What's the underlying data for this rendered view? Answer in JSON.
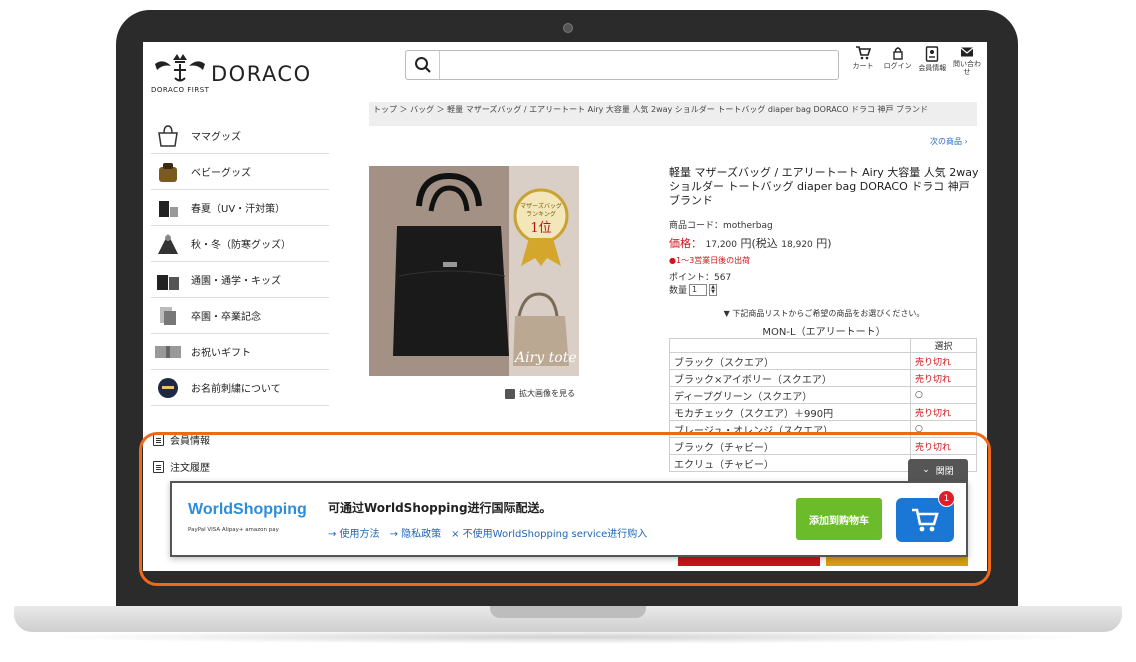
{
  "header": {
    "logo_name": "DORACO",
    "logo_sub": "DORACO FIRST",
    "search_placeholder": "",
    "icons": [
      {
        "label": "カート",
        "icon": "cart-icon"
      },
      {
        "label": "ログイン",
        "icon": "login-icon"
      },
      {
        "label": "会員情報",
        "icon": "member-icon"
      },
      {
        "label": "問い合わせ",
        "icon": "mail-icon"
      }
    ]
  },
  "breadcrumb": "トップ ＞ バッグ ＞ 軽量 マザーズバッグ / エアリートート Airy 大容量 人気 2way ショルダー トートバッグ diaper bag  DORACO ドラコ 神戸 ブランド",
  "next_link": "次の商品",
  "sidebar": {
    "items": [
      {
        "label": "ママグッズ"
      },
      {
        "label": "ベビーグッズ"
      },
      {
        "label": "春夏（UV・汗対策）"
      },
      {
        "label": "秋・冬（防寒グッズ）"
      },
      {
        "label": "通園・通学・キッズ"
      },
      {
        "label": "卒園・卒業記念"
      },
      {
        "label": "お祝いギフト"
      },
      {
        "label": "お名前刺繍について"
      }
    ],
    "links": [
      {
        "label": "会員情報"
      },
      {
        "label": "注文履歴"
      }
    ]
  },
  "product": {
    "badge_line1": "マザーズバッグ",
    "badge_line2": "ランキング",
    "badge_rank": "1位",
    "script_text": "Airy tote",
    "zoom_label": "拡大画像を見る",
    "title": "軽量 マザーズバッグ / エアリートート Airy 大容量 人気 2way ショルダー トートバッグ diaper bag DORACO ドラコ 神戸 ブランド",
    "code": "商品コード：motherbag",
    "price_label": "価格：",
    "price": "17,200",
    "price_tax_label": "円(税込",
    "price_tax": "18,920",
    "price_tail": "円)",
    "shipping": "●1〜3営業日後の出荷",
    "point": "ポイント：567",
    "qty_label": "数量",
    "qty_value": "1",
    "note": "▼ 下記商品リストからご希望の商品をお選びください。",
    "variant_title": "MON-L（エアリートート）",
    "table_header": "選択",
    "variants": [
      {
        "name": "ブラック（スクエア）",
        "status": "売り切れ"
      },
      {
        "name": "ブラック×アイボリー（スクエア）",
        "status": "売り切れ"
      },
      {
        "name": "ディープグリーン（スクエア）",
        "status": "○"
      },
      {
        "name": "モカチェック（スクエア）＋990円",
        "status": "売り切れ"
      },
      {
        "name": "ブレージュ・オレンジ（スクエア）",
        "status": "○"
      },
      {
        "name": "ブラック（チャビー）",
        "status": "売り切れ"
      },
      {
        "name": "エクリュ（チャビー）",
        "status": ""
      }
    ]
  },
  "worldshopping": {
    "close_label": "関閉",
    "logo": "WorldShopping",
    "payments": "PayPal  VISA  Alipay+  amazon pay",
    "message": "可通过WorldShopping进行国际配送。",
    "links": [
      "→ 使用方法",
      "→ 隐私政策",
      "× 不使用WorldShopping service进行购入"
    ],
    "add_button": "添加到购物车",
    "cart_badge": "1"
  },
  "colors": {
    "highlight": "#ee6a1b",
    "sold_out": "#d0141b",
    "ws_blue": "#1a77d6",
    "ws_green": "#6cbb2a"
  }
}
